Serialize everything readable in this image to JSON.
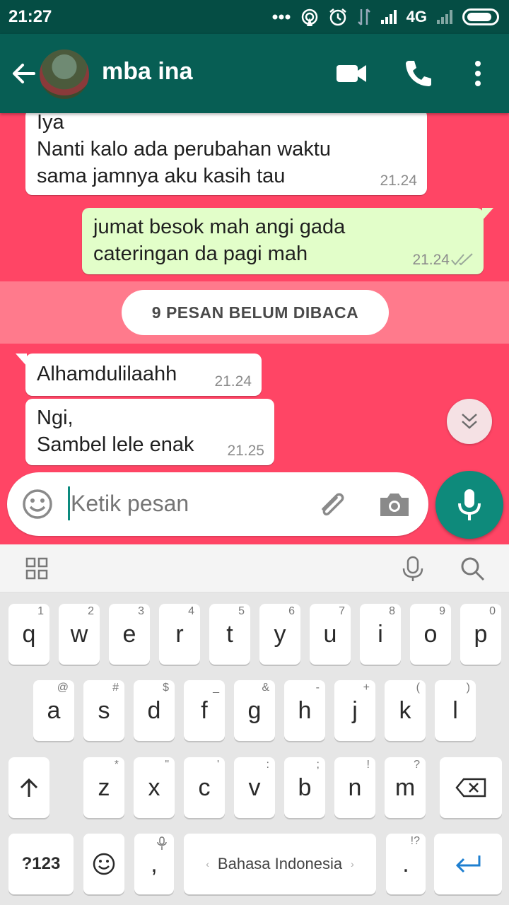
{
  "status_bar": {
    "time": "21:27",
    "network": "4G"
  },
  "header": {
    "contact_name": "mba ina"
  },
  "messages": [
    {
      "dir": "in",
      "text": "Iya\nNanti kalo ada perubahan waktu\nsama jamnya aku kasih tau",
      "time": "21.24"
    },
    {
      "dir": "out",
      "text": "jumat besok mah angi gada\ncateringan da pagi mah",
      "time": "21.24"
    },
    {
      "dir": "in",
      "text": "Alhamdulilaahh",
      "time": "21.24"
    },
    {
      "dir": "in",
      "text": "Ngi,\nSambel lele enak",
      "time": "21.25"
    }
  ],
  "unread_label": "9 PESAN BELUM DIBACA",
  "composer": {
    "placeholder": "Ketik pesan"
  },
  "keyboard": {
    "row1": [
      {
        "k": "q",
        "h": "1"
      },
      {
        "k": "w",
        "h": "2"
      },
      {
        "k": "e",
        "h": "3"
      },
      {
        "k": "r",
        "h": "4"
      },
      {
        "k": "t",
        "h": "5"
      },
      {
        "k": "y",
        "h": "6"
      },
      {
        "k": "u",
        "h": "7"
      },
      {
        "k": "i",
        "h": "8"
      },
      {
        "k": "o",
        "h": "9"
      },
      {
        "k": "p",
        "h": "0"
      }
    ],
    "row2": [
      {
        "k": "a",
        "h": "@"
      },
      {
        "k": "s",
        "h": "#"
      },
      {
        "k": "d",
        "h": "$"
      },
      {
        "k": "f",
        "h": "_"
      },
      {
        "k": "g",
        "h": "&"
      },
      {
        "k": "h",
        "h": "-"
      },
      {
        "k": "j",
        "h": "+"
      },
      {
        "k": "k",
        "h": "("
      },
      {
        "k": "l",
        "h": ")"
      }
    ],
    "row3": [
      {
        "k": "z",
        "h": "*"
      },
      {
        "k": "x",
        "h": "\""
      },
      {
        "k": "c",
        "h": "'"
      },
      {
        "k": "v",
        "h": ":"
      },
      {
        "k": "b",
        "h": ";"
      },
      {
        "k": "n",
        "h": "!"
      },
      {
        "k": "m",
        "h": "?"
      }
    ],
    "symbols_label": "?123",
    "comma": ",",
    "space_label": "Bahasa Indonesia",
    "period": ".",
    "period_hint": "!?"
  }
}
